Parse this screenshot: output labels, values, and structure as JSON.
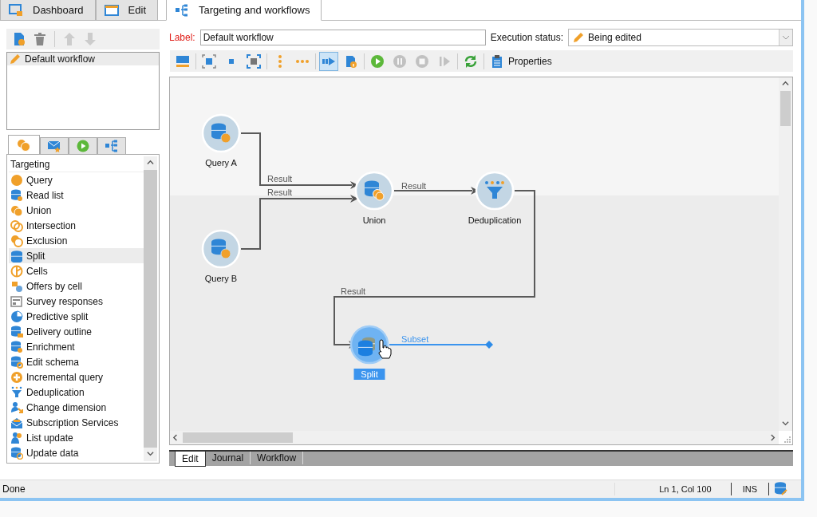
{
  "tabs": [
    {
      "label": "Dashboard",
      "kind": "dashboard",
      "selected": false
    },
    {
      "label": "Edit",
      "kind": "edit",
      "selected": false
    },
    {
      "label": "Targeting and workflows",
      "kind": "workflow",
      "selected": true
    }
  ],
  "workflows": [
    {
      "label": "Default workflow",
      "selected": true
    }
  ],
  "palette_tabs": [
    {
      "kind": "targeting",
      "selected": true
    },
    {
      "kind": "delivery",
      "selected": false
    },
    {
      "kind": "flow",
      "selected": false
    },
    {
      "kind": "tools",
      "selected": false
    }
  ],
  "palette": {
    "header": "Targeting",
    "items": [
      {
        "label": "Query",
        "kind": "query",
        "selected": false
      },
      {
        "label": "Read list",
        "kind": "readlist",
        "selected": false
      },
      {
        "label": "Union",
        "kind": "union",
        "selected": false
      },
      {
        "label": "Intersection",
        "kind": "intersection",
        "selected": false
      },
      {
        "label": "Exclusion",
        "kind": "exclusion",
        "selected": false
      },
      {
        "label": "Split",
        "kind": "split",
        "selected": true
      },
      {
        "label": "Cells",
        "kind": "cells",
        "selected": false
      },
      {
        "label": "Offers by cell",
        "kind": "offers",
        "selected": false
      },
      {
        "label": "Survey responses",
        "kind": "survey",
        "selected": false
      },
      {
        "label": "Predictive split",
        "kind": "predictive",
        "selected": false
      },
      {
        "label": "Delivery outline",
        "kind": "delivery",
        "selected": false
      },
      {
        "label": "Enrichment",
        "kind": "enrichment",
        "selected": false
      },
      {
        "label": "Edit schema",
        "kind": "schema",
        "selected": false
      },
      {
        "label": "Incremental query",
        "kind": "incremental",
        "selected": false
      },
      {
        "label": "Deduplication",
        "kind": "dedup",
        "selected": false
      },
      {
        "label": "Change dimension",
        "kind": "dimension",
        "selected": false
      },
      {
        "label": "Subscription Services",
        "kind": "subscription",
        "selected": false
      },
      {
        "label": "List update",
        "kind": "listupdate",
        "selected": false
      },
      {
        "label": "Update data",
        "kind": "update",
        "selected": false
      }
    ]
  },
  "form": {
    "label_caption": "Label:",
    "label_value": "Default workflow",
    "status_caption": "Execution status:",
    "status_value": "Being edited"
  },
  "toolbar": [
    [
      {
        "kind": "layout",
        "selected": false,
        "disabled": false
      }
    ],
    [
      {
        "kind": "fit",
        "selected": false,
        "disabled": false
      },
      {
        "kind": "small",
        "selected": false,
        "disabled": false
      },
      {
        "kind": "zoom",
        "selected": false,
        "disabled": false
      }
    ],
    [
      {
        "kind": "vdots",
        "selected": false,
        "disabled": false
      },
      {
        "kind": "hdots",
        "selected": false,
        "disabled": false
      }
    ],
    [
      {
        "kind": "pointer",
        "selected": true,
        "disabled": false
      },
      {
        "kind": "info",
        "selected": false,
        "disabled": false
      }
    ],
    [
      {
        "kind": "start",
        "selected": false,
        "disabled": false
      },
      {
        "kind": "pause",
        "selected": false,
        "disabled": true
      },
      {
        "kind": "stop",
        "selected": false,
        "disabled": true
      },
      {
        "kind": "step",
        "selected": false,
        "disabled": true
      }
    ],
    [
      {
        "kind": "refresh",
        "selected": false,
        "disabled": false
      }
    ],
    [
      {
        "kind": "properties",
        "label": "Properties",
        "selected": false,
        "disabled": false
      }
    ]
  ],
  "workflow": {
    "nodes": [
      {
        "label": "Query A",
        "kind": "query",
        "selected": false
      },
      {
        "label": "Union",
        "kind": "union",
        "selected": false
      },
      {
        "label": "Deduplication",
        "kind": "dedup",
        "selected": false
      },
      {
        "label": "Query B",
        "kind": "query",
        "selected": false
      },
      {
        "label": "Split",
        "kind": "split",
        "selected": true
      }
    ],
    "edges": [
      {
        "label": "Result",
        "selected": false
      },
      {
        "label": "Result",
        "selected": false
      },
      {
        "label": "Result",
        "selected": false
      },
      {
        "label": "Result",
        "selected": false
      },
      {
        "label": "Subset",
        "selected": true
      }
    ]
  },
  "bottom_tabs": [
    {
      "label": "Edit",
      "selected": true
    },
    {
      "label": "Journal",
      "selected": false
    },
    {
      "label": "Workflow",
      "selected": false
    }
  ],
  "status_bar": {
    "message": "Done",
    "position": "Ln 1, Col 100",
    "mode": "INS"
  }
}
